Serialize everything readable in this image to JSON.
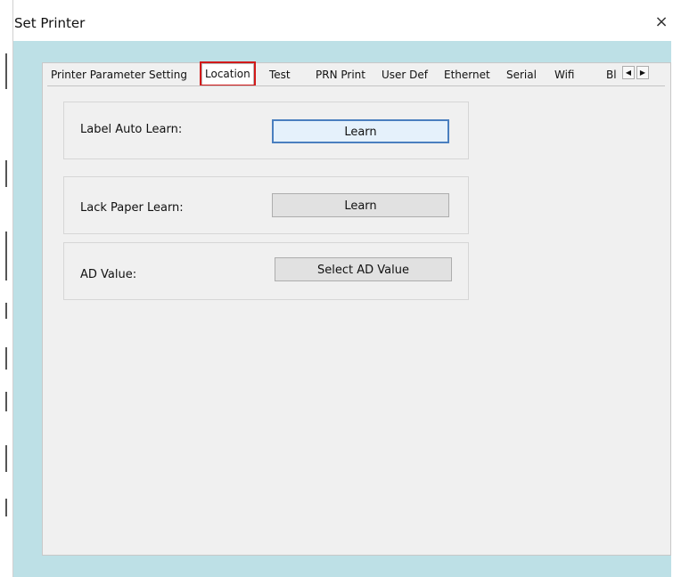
{
  "window": {
    "title": "Set Printer",
    "close_glyph": "×"
  },
  "tabs": [
    {
      "label": "Printer Parameter Setting"
    },
    {
      "label": "Location",
      "active": true
    },
    {
      "label": "Test"
    },
    {
      "label": "PRN Print"
    },
    {
      "label": "User Def"
    },
    {
      "label": "Ethernet"
    },
    {
      "label": "Serial"
    },
    {
      "label": "Wifi"
    },
    {
      "label": "Bl"
    }
  ],
  "tab_scroll": {
    "left_glyph": "◀",
    "right_glyph": "▶"
  },
  "location": {
    "label_auto_learn": {
      "label": "Label Auto Learn:",
      "button": "Learn"
    },
    "lack_paper_learn": {
      "label": "Lack Paper Learn:",
      "button": "Learn"
    },
    "ad_value": {
      "label": "AD Value:",
      "button": "Select AD Value"
    }
  },
  "colors": {
    "client_bg": "#bde0e6",
    "dialog_bg": "#f0f0f0",
    "highlight": "#d21a1a",
    "default_button_border": "#4a7fbf"
  }
}
